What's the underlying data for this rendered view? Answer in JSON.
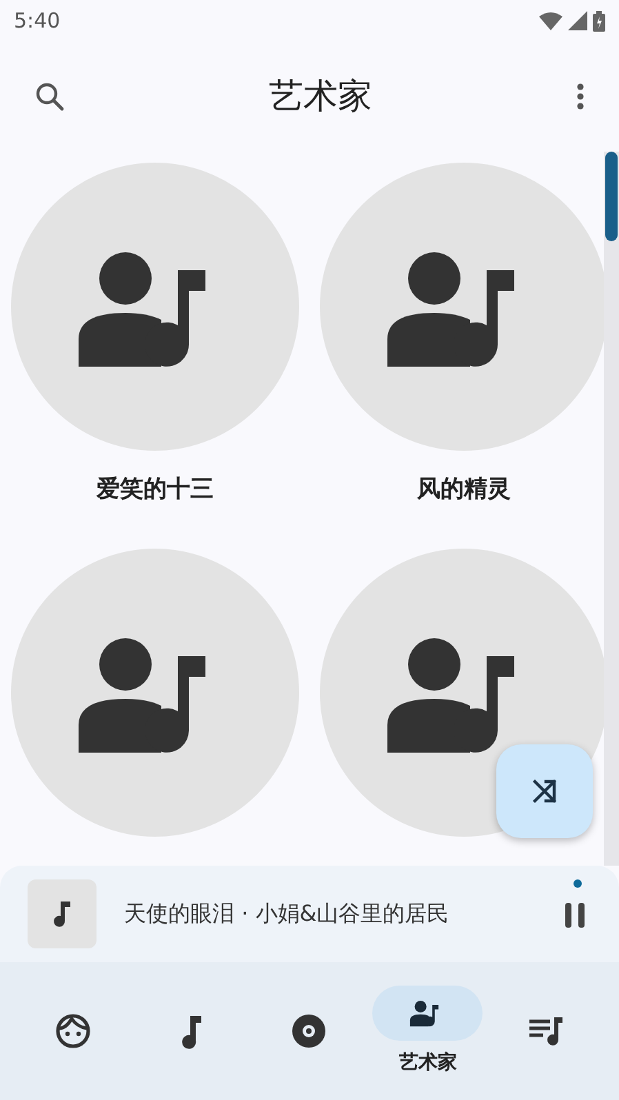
{
  "status_bar": {
    "time": "5:40"
  },
  "app_bar": {
    "title": "艺术家"
  },
  "artists": [
    {
      "kind": "artist",
      "name": "爱笑的十三"
    },
    {
      "kind": "artist",
      "name": "风的精灵"
    },
    {
      "kind": "artist"
    },
    {
      "kind": "artist"
    }
  ],
  "now_playing": {
    "title": "天使的眼泪 · 小娟&山谷里的居民",
    "playing": true
  },
  "nav": [
    {
      "selected": false
    },
    {
      "selected": false
    },
    {
      "selected": false
    },
    {
      "selected": true,
      "label": "艺术家"
    },
    {
      "selected": false
    }
  ]
}
